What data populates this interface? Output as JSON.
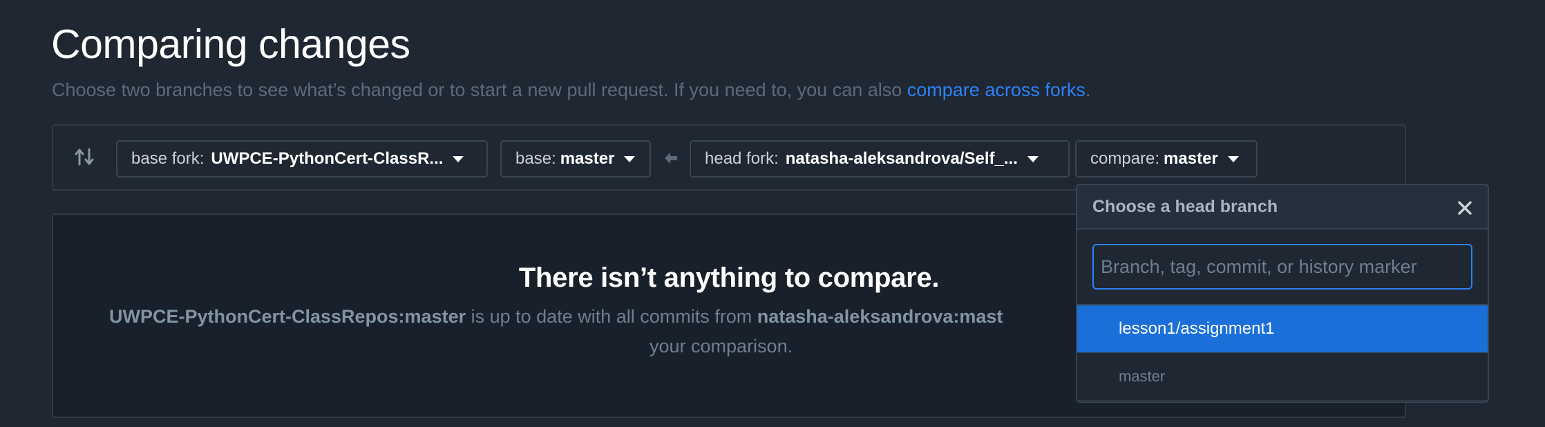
{
  "header": {
    "title": "Comparing changes",
    "subtitle_text": "Choose two branches to see what’s changed or to start a new pull request. If you need to, you can also ",
    "subtitle_link": "compare across forks",
    "subtitle_end": "."
  },
  "range": {
    "base_fork_label": "base fork:",
    "base_fork_value": "UWPCE-PythonCert-ClassR...",
    "base_label": "base:",
    "base_value": "master",
    "head_fork_label": "head fork:",
    "head_fork_value": "natasha-aleksandrova/Self_...",
    "compare_label": "compare:",
    "compare_value": "master"
  },
  "blankslate": {
    "title": "There isn’t anything to compare.",
    "base_ref": "UWPCE-PythonCert-ClassRepos:master",
    "middle_text": " is up to date with all commits from ",
    "head_ref": "natasha-aleksandrova:mast",
    "line2": "your comparison."
  },
  "dropdown": {
    "title": "Choose a head branch",
    "filter_placeholder": "Branch, tag, commit, or history marker",
    "items": [
      {
        "label": "lesson1/assignment1",
        "selected": true
      },
      {
        "label": "master",
        "selected": false
      }
    ]
  },
  "colors": {
    "background": "#1e2732",
    "accent": "#2f81f7",
    "selected": "#1b6fd8"
  }
}
